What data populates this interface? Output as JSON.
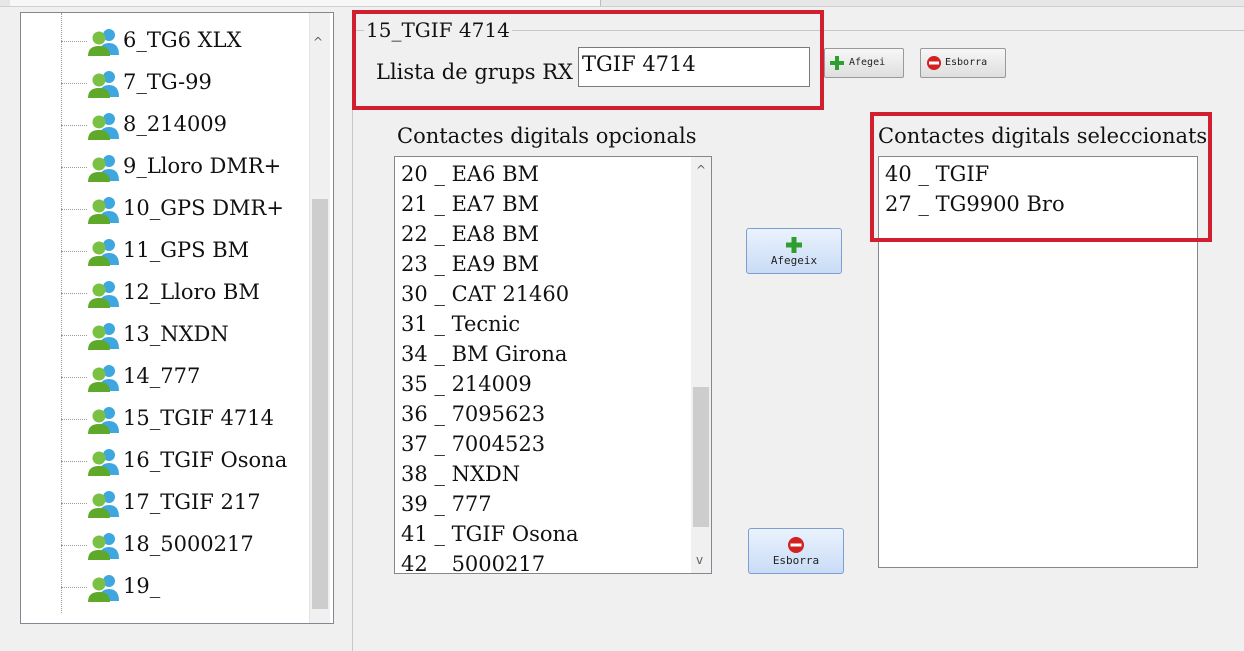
{
  "tree": {
    "items": [
      {
        "label": "6_TG6 XLX"
      },
      {
        "label": "7_TG-99"
      },
      {
        "label": "8_214009"
      },
      {
        "label": "9_Lloro DMR+"
      },
      {
        "label": "10_GPS DMR+"
      },
      {
        "label": "11_GPS BM"
      },
      {
        "label": "12_Lloro BM"
      },
      {
        "label": "13_NXDN"
      },
      {
        "label": "14_777"
      },
      {
        "label": "15_TGIF 4714"
      },
      {
        "label": "16_TGIF Osona"
      },
      {
        "label": "17_TGIF 217"
      },
      {
        "label": "18_5000217"
      },
      {
        "label": "19_"
      }
    ],
    "item_icon": "user-group-icon"
  },
  "group": {
    "legend": "15_TGIF 4714",
    "rx_label": "Llista de grups RX",
    "rx_value": "TGIF 4714",
    "add_small_label": "Afegei",
    "delete_small_label": "Esborra"
  },
  "optional": {
    "title": "Contactes digitals opcionals",
    "rows": [
      "20 _ EA6 BM",
      "21 _ EA7 BM",
      "22 _ EA8 BM",
      "23 _ EA9 BM",
      "30 _ CAT 21460",
      "31 _ Tecnic",
      "34 _ BM Girona",
      "35 _ 214009",
      "36 _ 7095623",
      "37 _ 7004523",
      "38 _ NXDN",
      "39 _ 777",
      "41 _ TGIF Osona",
      "42 _ 5000217"
    ]
  },
  "buttons": {
    "add_label": "Afegeix",
    "delete_label": "Esborra"
  },
  "selected": {
    "title": "Contactes digitals seleccionats",
    "rows": [
      "40 _ TGIF",
      "27 _ TG9900 Bro"
    ]
  },
  "colors": {
    "highlight": "#d11f2f",
    "add_icon": "#2e9e2e",
    "delete_icon": "#d32020"
  }
}
